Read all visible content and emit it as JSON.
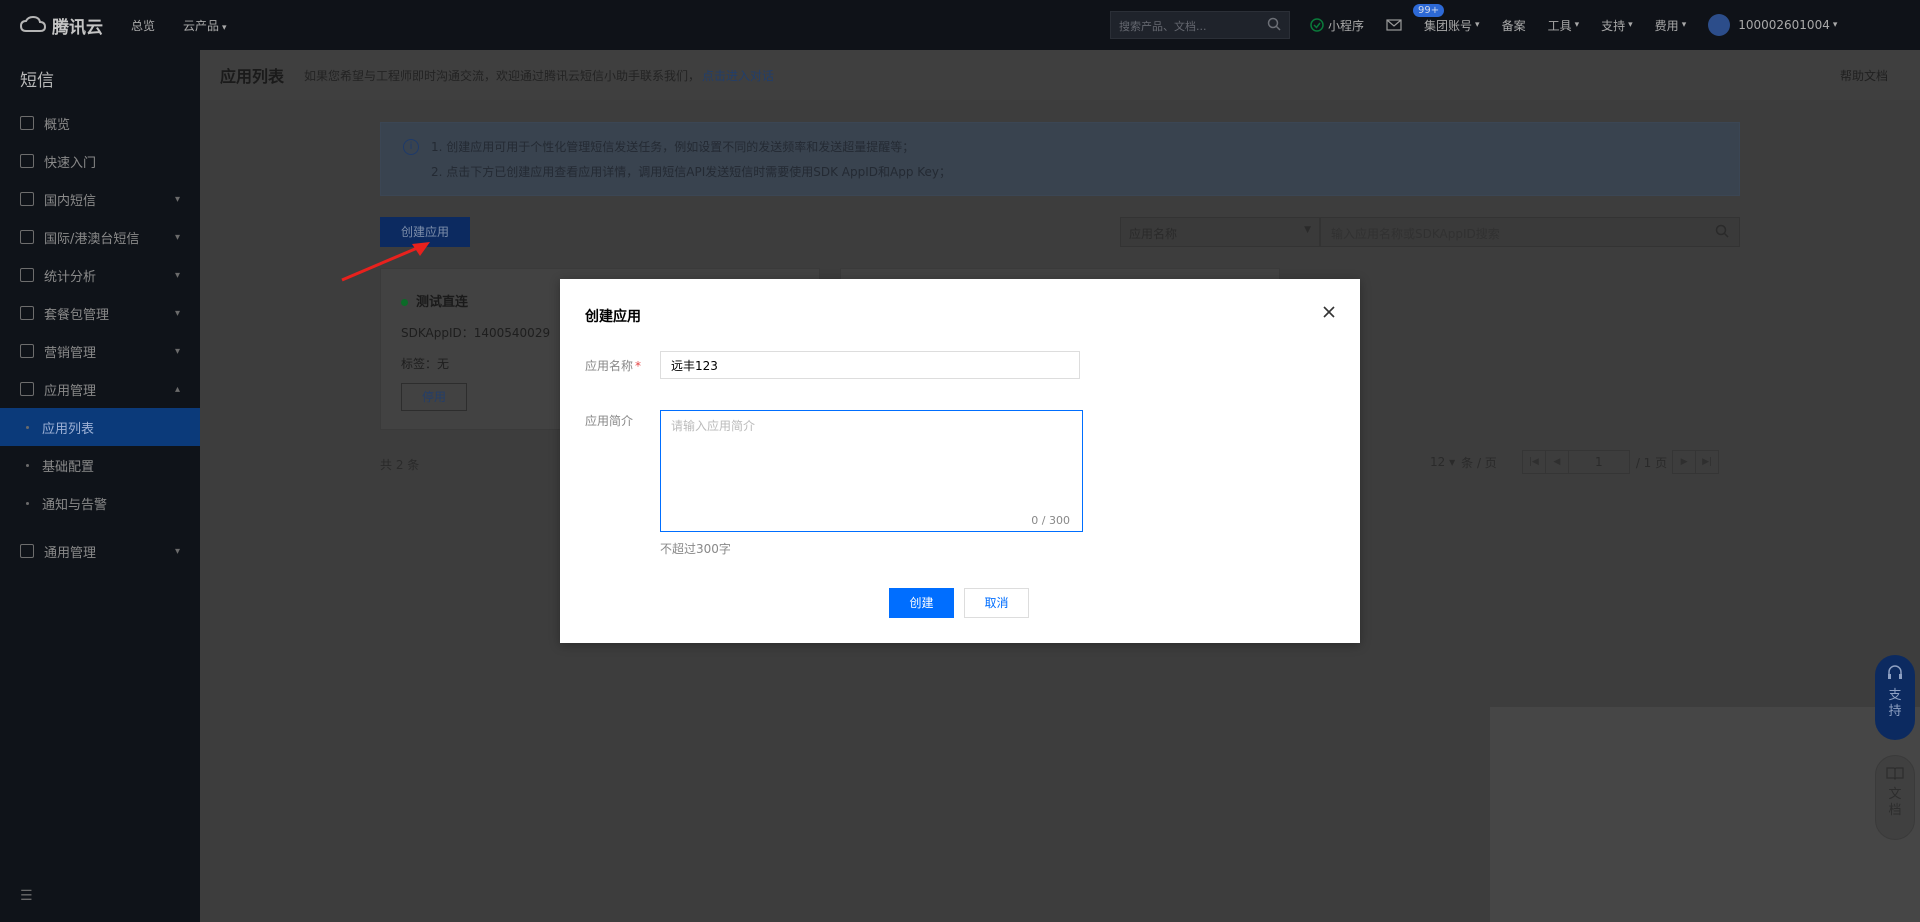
{
  "topnav": {
    "logo_text": "腾讯云",
    "overview": "总览",
    "products": "云产品",
    "search_placeholder": "搜索产品、文档...",
    "mini_program": "小程序",
    "mail_badge": "99+",
    "group_account": "集团账号",
    "filing": "备案",
    "tools": "工具",
    "support": "支持",
    "billing": "费用",
    "account_id": "100002601004"
  },
  "sidebar": {
    "title": "短信",
    "items": [
      {
        "label": "概览"
      },
      {
        "label": "快速入门"
      },
      {
        "label": "国内短信"
      },
      {
        "label": "国际/港澳台短信"
      },
      {
        "label": "统计分析"
      },
      {
        "label": "套餐包管理"
      },
      {
        "label": "营销管理"
      },
      {
        "label": "应用管理"
      }
    ],
    "subitems": [
      {
        "label": "应用列表"
      },
      {
        "label": "基础配置"
      },
      {
        "label": "通知与告警"
      }
    ],
    "general": "通用管理"
  },
  "header": {
    "title": "应用列表",
    "message": "如果您希望与工程师即时沟通交流，欢迎通过腾讯云短信小助手联系我们，",
    "link": "点击进入对话",
    "help": "帮助文档"
  },
  "notice": {
    "line1": "1. 创建应用可用于个性化管理短信发送任务，例如设置不同的发送频率和发送超量提醒等；",
    "line2": "2. 点击下方已创建应用查看应用详情，调用短信API发送短信时需要使用SDK AppID和App Key；"
  },
  "toolbar": {
    "create_label": "创建应用",
    "filter_select": "应用名称",
    "filter_placeholder": "输入应用名称或SDKAppID搜索"
  },
  "cards": [
    {
      "title": "测试直连",
      "sdk": "SDKAppID：1400540029",
      "tag": "标签：无",
      "stop": "停用"
    }
  ],
  "pagination": {
    "total": "共 2 条",
    "per_page": "12",
    "per_page_unit": "条 / 页",
    "page": "1",
    "pages": "/ 1 页"
  },
  "float": {
    "support": "支持",
    "doc": "文档"
  },
  "modal": {
    "title": "创建应用",
    "name_label": "应用名称",
    "name_value": "远丰123",
    "desc_label": "应用简介",
    "desc_placeholder": "请输入应用简介",
    "desc_count": "0 / 300",
    "hint": "不超过300字",
    "ok": "创建",
    "cancel": "取消"
  },
  "colors": {
    "primary": "#006eff",
    "required": "#e54545",
    "arrow": "#e8211d"
  }
}
